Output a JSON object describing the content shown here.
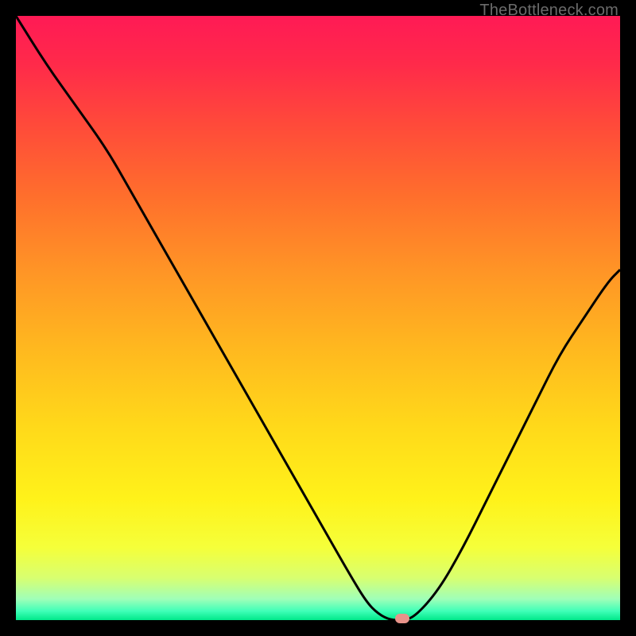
{
  "watermark": "TheBottleneck.com",
  "colors": {
    "gradient_stops": [
      {
        "offset": 0.0,
        "color": "#ff1a55"
      },
      {
        "offset": 0.08,
        "color": "#ff2a4a"
      },
      {
        "offset": 0.18,
        "color": "#ff4a3a"
      },
      {
        "offset": 0.3,
        "color": "#ff6f2c"
      },
      {
        "offset": 0.42,
        "color": "#ff9426"
      },
      {
        "offset": 0.55,
        "color": "#ffb81f"
      },
      {
        "offset": 0.68,
        "color": "#ffd91a"
      },
      {
        "offset": 0.8,
        "color": "#fff21a"
      },
      {
        "offset": 0.88,
        "color": "#f5ff3a"
      },
      {
        "offset": 0.93,
        "color": "#d8ff70"
      },
      {
        "offset": 0.965,
        "color": "#a0ffb8"
      },
      {
        "offset": 0.985,
        "color": "#40ffb8"
      },
      {
        "offset": 1.0,
        "color": "#00e88a"
      }
    ],
    "curve": "#000000",
    "marker": "#e8938a",
    "black": "#000000"
  },
  "chart_data": {
    "type": "line",
    "title": "",
    "xlabel": "",
    "ylabel": "",
    "xlim": [
      0,
      100
    ],
    "ylim": [
      0,
      100
    ],
    "x": [
      0,
      5,
      10,
      15,
      19,
      23,
      27,
      31,
      35,
      39,
      43,
      47,
      51,
      55,
      58,
      60,
      62,
      64,
      66,
      70,
      74,
      78,
      82,
      86,
      90,
      94,
      98,
      100
    ],
    "values": [
      100,
      92,
      85,
      78,
      71,
      64,
      57,
      50,
      43,
      36,
      29,
      22,
      15,
      8,
      3,
      1,
      0,
      0,
      0.5,
      5,
      12,
      20,
      28,
      36,
      44,
      50,
      56,
      58
    ],
    "series_name": "bottleneck",
    "marker": {
      "x": 64,
      "y": 0
    }
  }
}
